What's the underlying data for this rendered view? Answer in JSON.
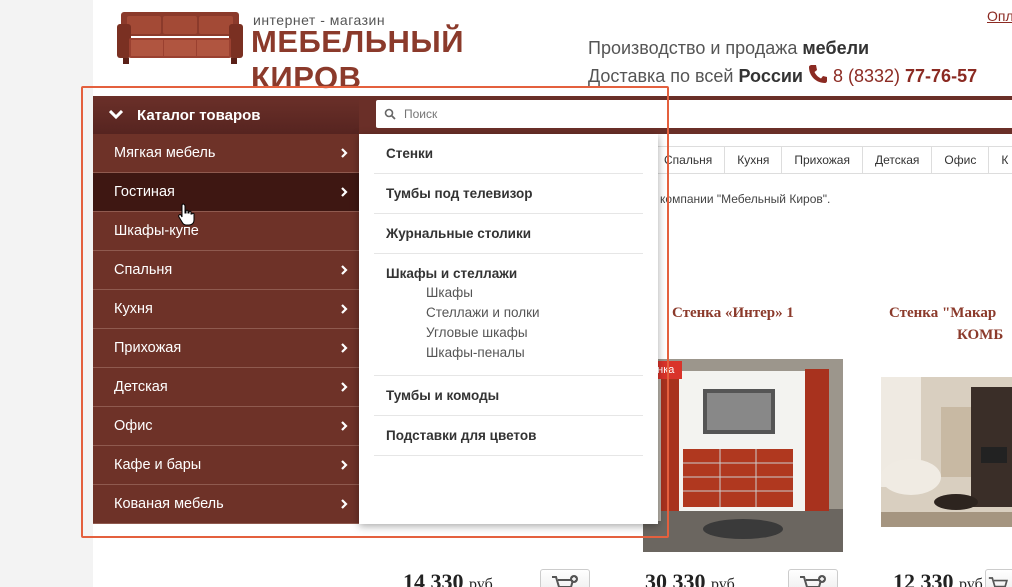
{
  "top_link": "Опл",
  "logo": {
    "small": "интернет - магазин",
    "big": "МЕБЕЛЬНЫЙ КИРОВ"
  },
  "header": {
    "line1_text": "Производство и продажа ",
    "line1_bold": "мебели",
    "line2_text": "Доставка по всей ",
    "line2_bold": "России",
    "phone_prefix": " 8 (8332) ",
    "phone_number": "77-76-57"
  },
  "catalog": {
    "title": "Каталог товаров",
    "items": [
      {
        "label": "Мягкая мебель",
        "arrow": true
      },
      {
        "label": "Гостиная",
        "arrow": true,
        "active": true
      },
      {
        "label": "Шкафы-купе",
        "arrow": false
      },
      {
        "label": "Спальня",
        "arrow": true
      },
      {
        "label": "Кухня",
        "arrow": true
      },
      {
        "label": "Прихожая",
        "arrow": true
      },
      {
        "label": "Детская",
        "arrow": true
      },
      {
        "label": "Офис",
        "arrow": true
      },
      {
        "label": "Кафе и бары",
        "arrow": true
      },
      {
        "label": "Кованая мебель",
        "arrow": true
      }
    ]
  },
  "search": {
    "placeholder": "Поиск"
  },
  "dropdown": {
    "items": [
      {
        "label": "Стенки"
      },
      {
        "label": "Тумбы под телевизор"
      },
      {
        "label": "Журнальные столики"
      },
      {
        "label": "Шкафы и стеллажи",
        "sub": [
          "Шкафы",
          "Стеллажи и полки",
          "Угловые шкафы",
          "Шкафы-пеналы"
        ]
      },
      {
        "label": "Тумбы и комоды"
      },
      {
        "label": "Подставки для цветов"
      }
    ]
  },
  "tabs": [
    "Спальня",
    "Кухня",
    "Прихожая",
    "Детская",
    "Офис",
    "К"
  ],
  "breadcrumb": "е компании \"Мебельный Киров\".",
  "products": [
    {
      "title": "Стенка «Интер» 1",
      "badge": "инка",
      "price": "30 330",
      "currency": "руб"
    },
    {
      "title_line1": "Стенка \"Макар",
      "title_line2": "КОМБ",
      "price": "12 330",
      "currency": "руб"
    }
  ],
  "hidden_price": {
    "price": "14 330",
    "currency": "руб"
  },
  "colors": {
    "brand": "#8b3a2b",
    "menu_bg": "#6e3228",
    "menu_active": "#3e1712",
    "highlight": "#e4603e",
    "badge": "#d9332a"
  }
}
